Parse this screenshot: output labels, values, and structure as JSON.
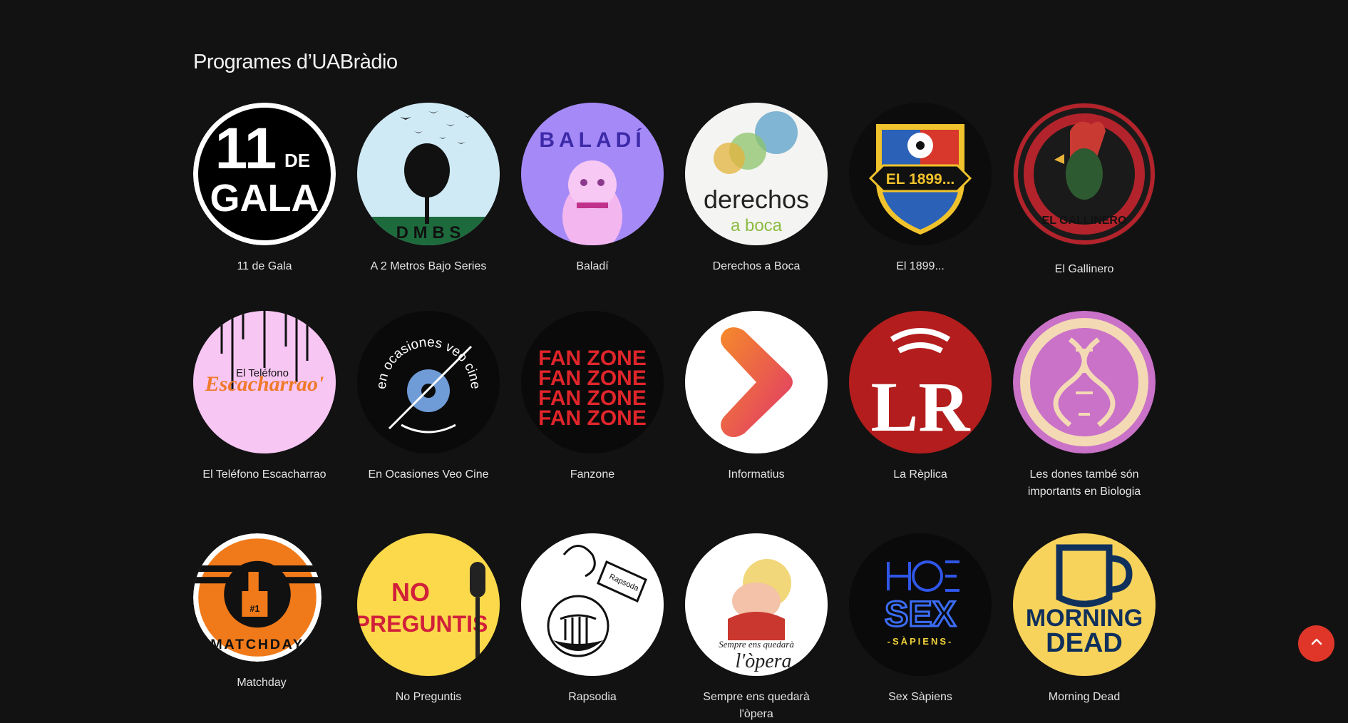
{
  "page": {
    "title": "Programes d’UABràdio"
  },
  "programs": [
    {
      "name": "11 de Gala",
      "icon": "11-de-gala-logo",
      "logo_texts": [
        "11",
        "DE",
        "GALA"
      ]
    },
    {
      "name": "A 2 Metros Bajo Series",
      "icon": "tree-birds-logo",
      "logo_texts": [
        "D M B S"
      ]
    },
    {
      "name": "Baladí",
      "icon": "lucky-cat-logo",
      "logo_texts": [
        "BALADÍ"
      ]
    },
    {
      "name": "Derechos a Boca",
      "icon": "circles-logo",
      "logo_texts": [
        "derechos",
        "a boca"
      ]
    },
    {
      "name": "El 1899...",
      "icon": "football-crest-logo",
      "logo_texts": [
        "EL 1899..."
      ]
    },
    {
      "name": "El Gallinero",
      "icon": "rooster-logo",
      "logo_texts": [
        "EL GALLINERO"
      ]
    },
    {
      "name": "El Teléfono Escacharrao",
      "icon": "telephone-logo",
      "logo_texts": [
        "El Teléfono",
        "Escacharrao'"
      ]
    },
    {
      "name": "En Ocasiones Veo Cine",
      "icon": "disc-logo",
      "logo_texts": [
        "en ocasiones veo cine"
      ]
    },
    {
      "name": "Fanzone",
      "icon": "fanzone-logo",
      "logo_texts": [
        "FAN ZONE"
      ]
    },
    {
      "name": "Informatius",
      "icon": "play-arrow-logo",
      "logo_texts": []
    },
    {
      "name": "La Rèplica",
      "icon": "lr-logo",
      "logo_texts": [
        "LR"
      ]
    },
    {
      "name": "Les dones també són importants en Biologia",
      "icon": "dna-logo",
      "logo_texts": []
    },
    {
      "name": "Matchday",
      "icon": "foam-finger-logo",
      "logo_texts": [
        "MATCHDAY",
        "#1"
      ]
    },
    {
      "name": "No Preguntis",
      "icon": "microphone-logo",
      "logo_texts": [
        "NO",
        "PREGUNTIS"
      ]
    },
    {
      "name": "Rapsodia",
      "icon": "lyre-urn-logo",
      "logo_texts": [
        "Rapsoda"
      ]
    },
    {
      "name": "Sempre ens quedarà l'òpera",
      "icon": "opera-singer-logo",
      "logo_texts": [
        "Sempre ens quedarà",
        "l'òpera"
      ]
    },
    {
      "name": "Sex Sàpiens",
      "icon": "neon-sex-logo",
      "logo_texts": [
        "SEX",
        "-SÀPIENS-"
      ]
    },
    {
      "name": "Morning Dead",
      "icon": "mug-logo",
      "logo_texts": [
        "MORNING",
        "DEAD"
      ]
    }
  ],
  "scroll_top": {
    "icon": "chevron-up-icon",
    "color": "#e0362a"
  }
}
